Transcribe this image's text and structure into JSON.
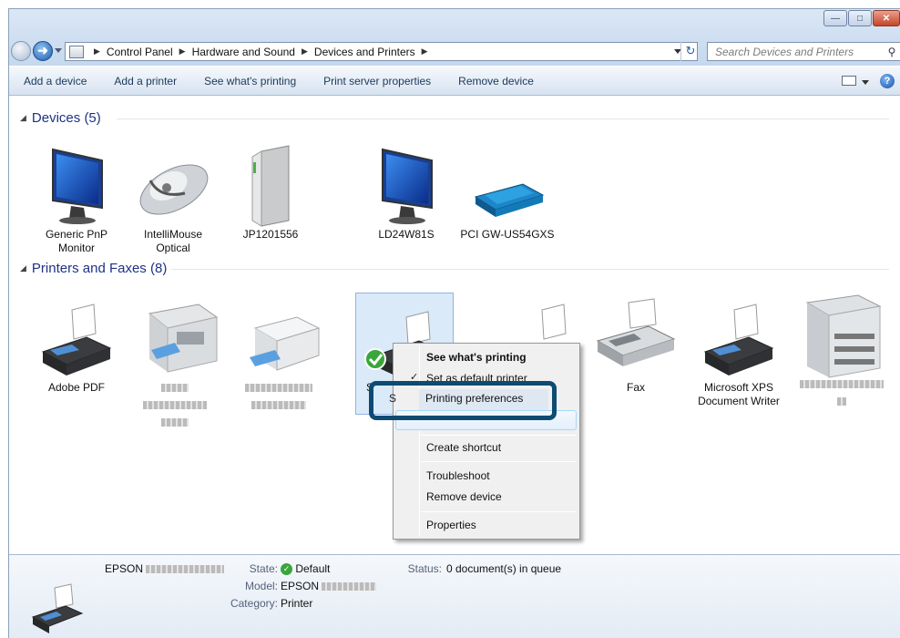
{
  "breadcrumb": [
    "Control Panel",
    "Hardware and Sound",
    "Devices and Printers"
  ],
  "search": {
    "placeholder": "Search Devices and Printers"
  },
  "toolbar": {
    "items": [
      "Add a device",
      "Add a printer",
      "See what's printing",
      "Print server properties",
      "Remove device"
    ]
  },
  "groups": {
    "devices": "Devices (5)",
    "printers": "Printers and Faxes (8)"
  },
  "devices": [
    {
      "line1": "Generic PnP",
      "line2": "Monitor",
      "icon": "monitor-icon"
    },
    {
      "line1": "IntelliMouse",
      "line2": "Optical",
      "icon": "mouse-icon"
    },
    {
      "line1": "JP1201556",
      "line2": "",
      "icon": "external-drive-icon"
    },
    {
      "line1": "LD24W81S",
      "line2": "",
      "icon": "monitor-icon"
    },
    {
      "line1": "PCI GW-US54GXS",
      "line2": "",
      "icon": "network-router-icon"
    }
  ],
  "printers": [
    {
      "line1": "Adobe PDF",
      "line2": "",
      "icon": "printer-icon"
    },
    {
      "line1": "",
      "line2": "",
      "icon": "multifunction-printer-icon"
    },
    {
      "line1": "",
      "line2": "",
      "icon": "inkjet-printer-icon"
    },
    {
      "line1": "S",
      "line2": "",
      "icon": "printer-icon"
    },
    {
      "line1": "",
      "line2": "",
      "icon": "printer-icon"
    },
    {
      "line1": "Fax",
      "line2": "",
      "icon": "fax-icon"
    },
    {
      "line1": "Microsoft XPS",
      "line2": "Document Writer",
      "icon": "printer-icon"
    },
    {
      "line1": "",
      "line2": "",
      "icon": "large-printer-icon"
    }
  ],
  "context_menu": {
    "see_whats_printing": "See what's printing",
    "set_default": "Set as default printer",
    "printing_preferences": "Printing preferences",
    "create_shortcut": "Create shortcut",
    "troubleshoot": "Troubleshoot",
    "remove_device": "Remove device",
    "properties": "Properties"
  },
  "status": {
    "name": "EPSON",
    "state_label": "State:",
    "state_value": "Default",
    "status_label": "Status:",
    "status_value": "0 document(s) in queue",
    "model_label": "Model:",
    "model_value": "EPSON",
    "category_label": "Category:",
    "category_value": "Printer"
  }
}
